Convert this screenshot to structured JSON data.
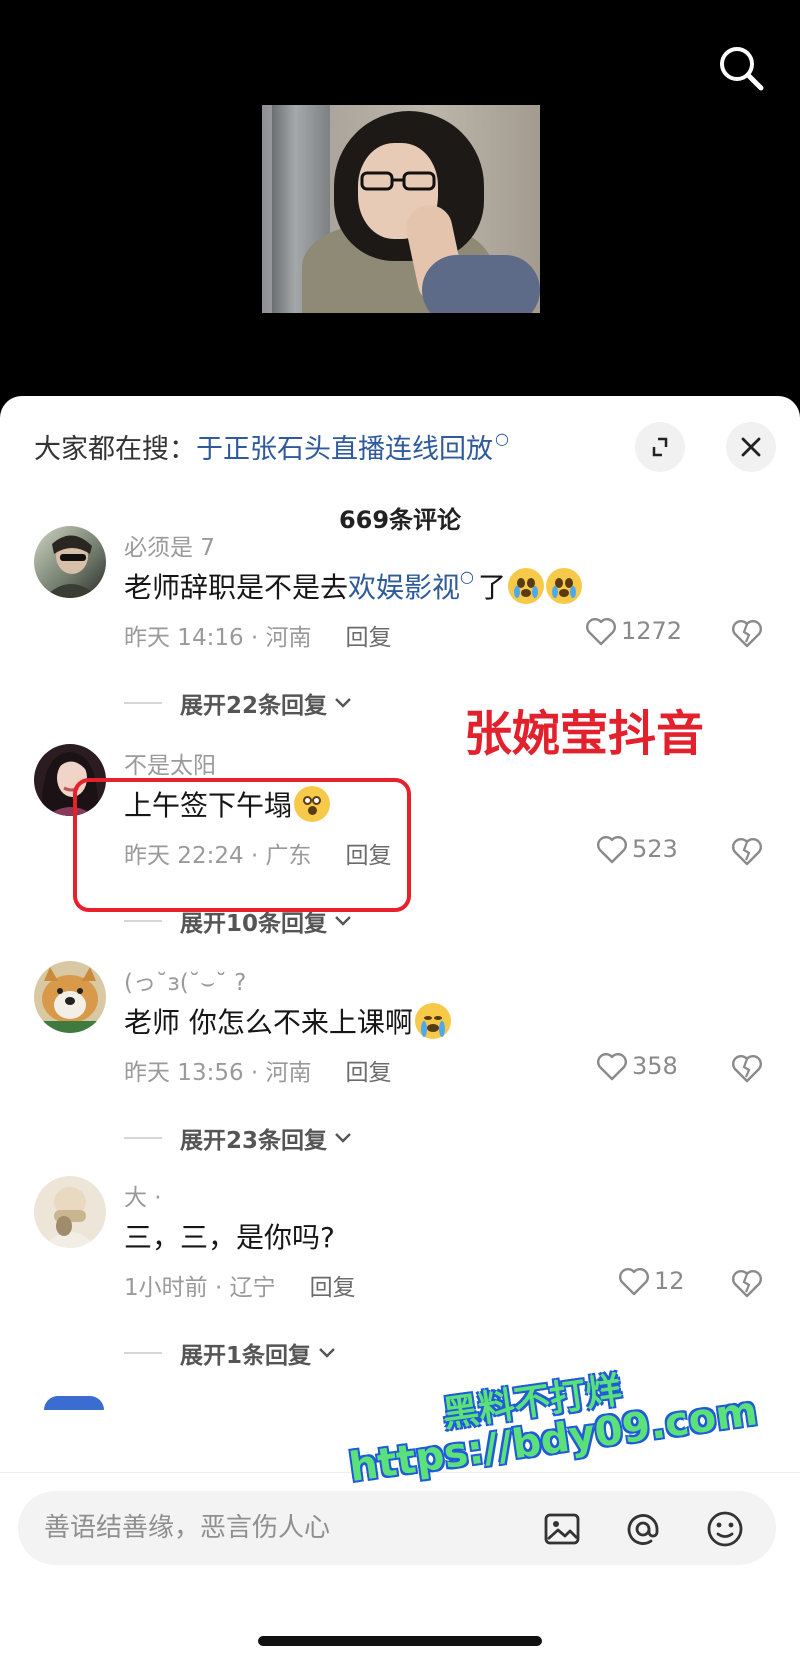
{
  "video": {
    "search_icon": "search-icon"
  },
  "sheet": {
    "hot_search_prefix": "大家都在搜：",
    "hot_search_link": "于正张石头直播连线回放",
    "expand_icon": "expand-icon",
    "close_icon": "close-icon",
    "comment_count": "669条评论"
  },
  "comments": [
    {
      "user": "必须是 7",
      "text_before": "老师辞职是不是去",
      "text_link": "欢娱影视",
      "text_after": "了",
      "emojis": [
        "crying-face-emoji",
        "crying-face-emoji"
      ],
      "time_location": "昨天 14:16 · 河南",
      "reply_label": "回复",
      "likes": "1272",
      "expand_replies": "展开22条回复"
    },
    {
      "user": "不是太阳",
      "text": "上午签下午塌",
      "emojis": [
        "shocked-face-emoji"
      ],
      "time_location": "昨天 22:24 · 广东",
      "reply_label": "回复",
      "likes": "523",
      "expand_replies": "展开10条回复"
    },
    {
      "user": "(っ˘з(˘⌣˘ ?",
      "text": "老师 你怎么不来上课啊",
      "emojis": [
        "crying-face-emoji"
      ],
      "time_location": "昨天 13:56 · 河南",
      "reply_label": "回复",
      "likes": "358",
      "expand_replies": "展开23条回复"
    },
    {
      "user": "大 ·",
      "text": "三，三，是你吗?",
      "time_location": "1小时前 · 辽宁",
      "reply_label": "回复",
      "likes": "12",
      "expand_replies": "展开1条回复"
    }
  ],
  "annotation": {
    "caption": "张婉莹抖音",
    "color": "#e3212d"
  },
  "input": {
    "placeholder": "善语结善缘，恶言伤人心",
    "icons": [
      "image-icon",
      "at-icon",
      "emoji-icon"
    ]
  },
  "watermark": {
    "line1": "黑料不打烊",
    "line2": "https://bdy09.com"
  },
  "colors": {
    "link": "#2f5a9c",
    "highlight_red": "#e8202c"
  }
}
